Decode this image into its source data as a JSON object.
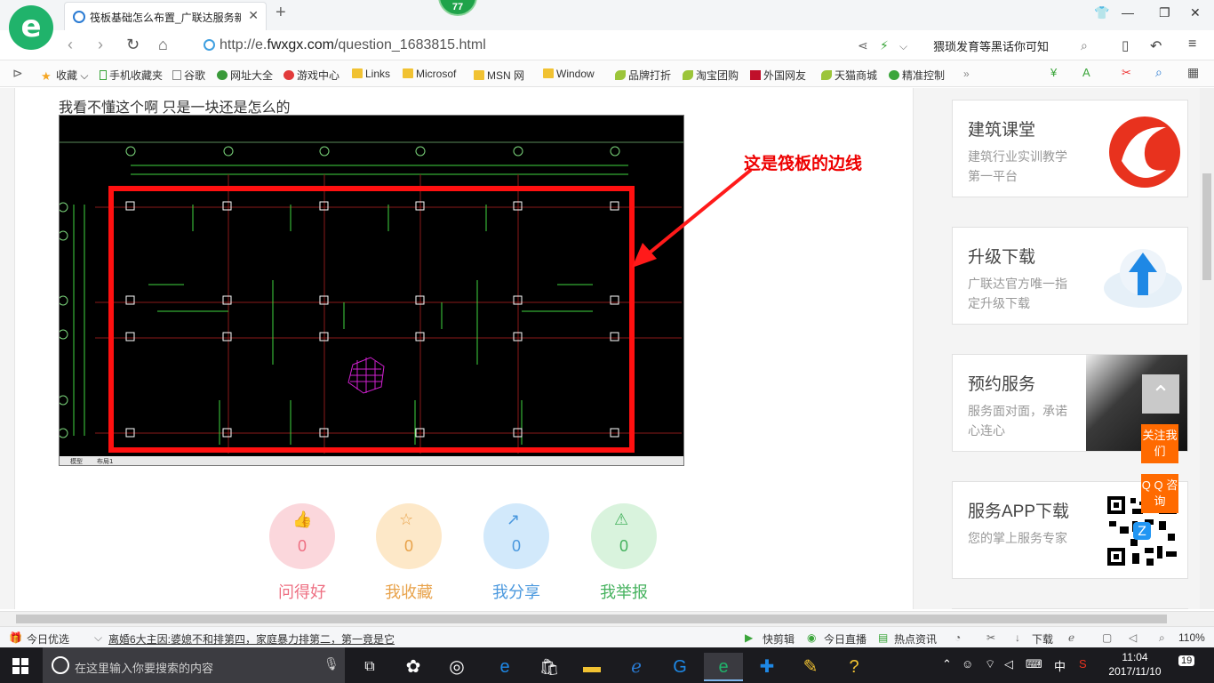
{
  "browser": {
    "badge": "77",
    "tab_title": "筏板基础怎么布置_广联达服务新干线",
    "url_host": "http://e.",
    "url_domain": "fwxgx.com",
    "url_path": "/question_1683815.html",
    "search_text": "猥琐发育等黑话你可知",
    "bookmarks": [
      "收藏",
      "手机收藏夹",
      "谷歌",
      "网址大全",
      "游戏中心",
      "Links",
      "Microsof",
      "MSN 网",
      "Window",
      "品牌打折",
      "淘宝团购",
      "外国网友",
      "天猫商城",
      "精准控制"
    ]
  },
  "question": {
    "text": "我看不懂这个啊 只是一块还是怎么的",
    "annotation": "这是筏板的边线",
    "cad_tabs": [
      "模型",
      "布局1"
    ]
  },
  "actions": [
    {
      "label": "问得好",
      "count": "0",
      "icon": "thumbs-up-icon",
      "bg": "#fbd7dc",
      "color": "#ee6f82"
    },
    {
      "label": "我收藏",
      "count": "0",
      "icon": "star-icon",
      "bg": "#fde8c8",
      "color": "#e8a24a"
    },
    {
      "label": "我分享",
      "count": "0",
      "icon": "share-icon",
      "bg": "#d2e9fb",
      "color": "#4a98de"
    },
    {
      "label": "我举报",
      "count": "0",
      "icon": "warning-icon",
      "bg": "#d9f3dd",
      "color": "#45b25e"
    }
  ],
  "sidebar": [
    {
      "title": "建筑课堂",
      "sub": "建筑行业实训教学第一平台"
    },
    {
      "title": "升级下载",
      "sub": "广联达官方唯一指定升级下载"
    },
    {
      "title": "预约服务",
      "sub": "服务面对面，承诺心连心"
    },
    {
      "title": "服务APP下载",
      "sub": "您的掌上服务专家"
    }
  ],
  "float": {
    "follow": "关注我们",
    "qq": "Q Q 咨询"
  },
  "statusbar": {
    "today": "今日优选",
    "news": "离婚6大主因:婆媳不和排第四，家庭暴力排第二，第一竟是它",
    "kuaijian": "快剪辑",
    "live": "今日直播",
    "hot": "热点资讯",
    "download": "下载",
    "zoom": "110%"
  },
  "taskbar": {
    "search_placeholder": "在这里输入你要搜索的内容",
    "ime": "中",
    "time": "11:04",
    "date": "2017/11/10",
    "notifications": "19"
  }
}
